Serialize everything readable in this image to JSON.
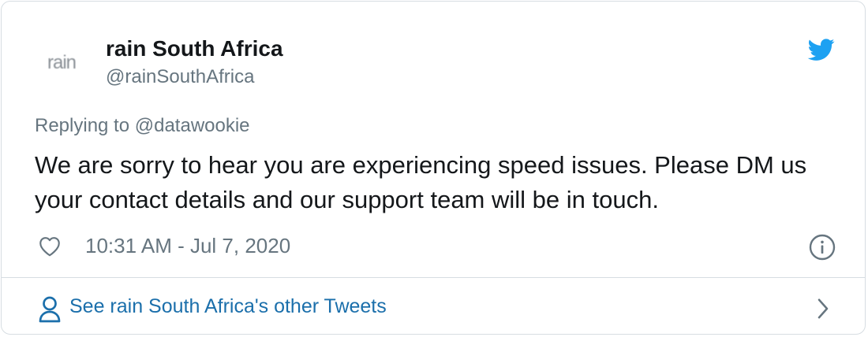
{
  "colors": {
    "brand": "#1da1f2",
    "link": "#1b6fab",
    "text_primary": "#14171a",
    "text_secondary": "#66757f",
    "border": "#d7dde2"
  },
  "author": {
    "avatar_text": "rain",
    "display_name": "rain South Africa",
    "handle": "@rainSouthAfrica"
  },
  "tweet": {
    "replying_to": "Replying to @datawookie",
    "text": "We are sorry to hear you are experiencing speed issues. Please DM us your contact details and our support team will be in touch.",
    "timestamp": "10:31 AM - Jul 7, 2020"
  },
  "footer": {
    "link_text": "See rain South Africa's other Tweets"
  },
  "icons": {
    "brand": "twitter-bird-icon",
    "like": "heart-icon",
    "info": "info-icon",
    "profile": "person-icon",
    "chevron": "chevron-right-icon"
  }
}
